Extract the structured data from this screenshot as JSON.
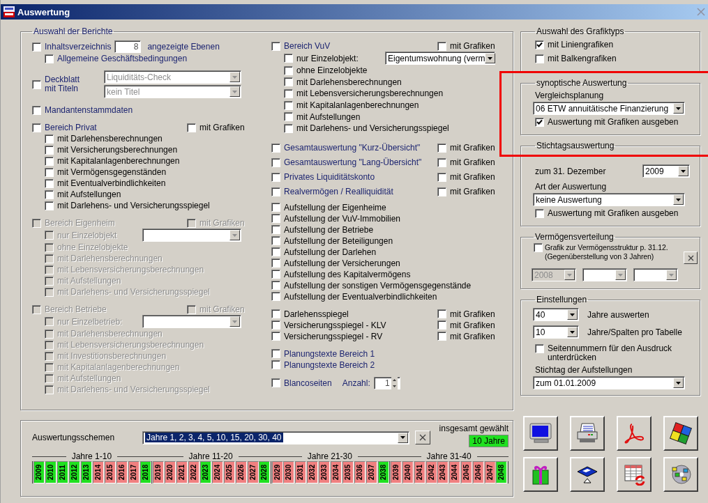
{
  "window": {
    "title": "Auswertung"
  },
  "report_selection": {
    "title": "Auswahl der Berichte",
    "columns": [
      {
        "groups": [
          {
            "disabled": false,
            "rows": [
              {
                "kind": "heading",
                "label": "Inhaltsverzeichnis",
                "checked": false,
                "field": {
                  "value": "8",
                  "suffix": "angezeigte Ebenen",
                  "spinner": false
                },
                "children": [
                  {
                    "kind": "heading",
                    "label": "Allgemeine Geschäftsbedingungen",
                    "checked": false
                  }
                ]
              }
            ]
          },
          {
            "disabled": false,
            "rows": [
              {
                "kind": "heading",
                "label": "Deckblatt mit Titeln",
                "checked": false,
                "dropdowns": [
                  {
                    "value": "Liquiditäts-Check",
                    "disabled": true
                  },
                  {
                    "value": "kein Titel",
                    "disabled": true
                  }
                ]
              }
            ]
          },
          {
            "disabled": false,
            "rows": [
              {
                "kind": "heading",
                "label": "Mandantenstammdaten",
                "checked": false
              }
            ]
          },
          {
            "disabled": false,
            "rows": [
              {
                "kind": "heading",
                "label": "Bereich Privat",
                "checked": false,
                "graphics": {
                  "label": "mit Grafiken",
                  "checked": false
                },
                "children": [
                  {
                    "kind": "option",
                    "label": "mit Darlehensberechnungen",
                    "checked": false
                  },
                  {
                    "kind": "option",
                    "label": "mit Versicherungsberechnungen",
                    "checked": false
                  },
                  {
                    "kind": "option",
                    "label": "mit Kapitalanlagenberechnungen",
                    "checked": false
                  },
                  {
                    "kind": "option",
                    "label": "mit Vermögensgegenständen",
                    "checked": false
                  },
                  {
                    "kind": "option",
                    "label": "mit Eventualverbindlichkeiten",
                    "checked": false
                  },
                  {
                    "kind": "option",
                    "label": "mit Aufstellungen",
                    "checked": false
                  },
                  {
                    "kind": "option",
                    "label": "mit Darlehens- und Versicherungsspiegel",
                    "checked": false
                  }
                ]
              }
            ]
          },
          {
            "disabled": true,
            "rows": [
              {
                "kind": "heading",
                "label": "Bereich Eigenheim",
                "checked": false,
                "graphics": {
                  "label": "mit Grafiken",
                  "checked": false
                },
                "children": [
                  {
                    "kind": "option",
                    "label": "nur Einzelobjekt",
                    "checked": false,
                    "dropdowns": [
                      {
                        "disabled": true
                      }
                    ]
                  },
                  {
                    "kind": "option",
                    "label": "ohne Einzelobjekte",
                    "checked": false
                  },
                  {
                    "kind": "option",
                    "label": "mit Darlehensberechnungen",
                    "checked": false
                  },
                  {
                    "kind": "option",
                    "label": "mit Lebensversicherungsberechnungen",
                    "checked": false
                  },
                  {
                    "kind": "option",
                    "label": "mit Aufstellungen",
                    "checked": false
                  },
                  {
                    "kind": "option",
                    "label": "mit Darlehens- und Versicherungsspiegel",
                    "checked": false
                  }
                ]
              }
            ]
          },
          {
            "disabled": true,
            "rows": [
              {
                "kind": "heading",
                "label": "Bereich Betriebe",
                "checked": false,
                "graphics": {
                  "label": "mit Grafiken",
                  "checked": false
                },
                "children": [
                  {
                    "kind": "option",
                    "label": "nur Einzelbetrieb:",
                    "checked": false,
                    "dropdowns": [
                      {
                        "disabled": true
                      }
                    ]
                  },
                  {
                    "kind": "option",
                    "label": "mit Darlehensberechnungen",
                    "checked": false
                  },
                  {
                    "kind": "option",
                    "label": "mit Lebensversicherungsberechnungen",
                    "checked": false
                  },
                  {
                    "kind": "option",
                    "label": "mit Investitionsberechnungen",
                    "checked": false
                  },
                  {
                    "kind": "option",
                    "label": "mit Kapitalanlagenberechnungen",
                    "checked": false
                  },
                  {
                    "kind": "option",
                    "label": "mit Aufstellungen",
                    "checked": false
                  },
                  {
                    "kind": "option",
                    "label": "mit Darlehens- und Versicherungsspiegel",
                    "checked": false
                  }
                ]
              }
            ]
          }
        ]
      },
      {
        "groups": [
          {
            "disabled": false,
            "rows": [
              {
                "kind": "heading",
                "label": "Bereich VuV",
                "checked": false,
                "graphics": {
                  "label": "mit Grafiken",
                  "checked": false
                },
                "children": [
                  {
                    "kind": "option",
                    "label": "nur Einzelobjekt:",
                    "checked": false,
                    "dropdowns": [
                      {
                        "value": "Eigentumswohnung (verm",
                        "disabled": false
                      }
                    ]
                  },
                  {
                    "kind": "option",
                    "label": "ohne Einzelobjekte",
                    "checked": false
                  },
                  {
                    "kind": "option",
                    "label": "mit Darlehensberechnungen",
                    "checked": false
                  },
                  {
                    "kind": "option",
                    "label": "mit Lebensversicherungsberechnungen",
                    "checked": false
                  },
                  {
                    "kind": "option",
                    "label": "mit Kapitalanlagenberechnungen",
                    "checked": false
                  },
                  {
                    "kind": "option",
                    "label": "mit Aufstellungen",
                    "checked": false
                  },
                  {
                    "kind": "option",
                    "label": "mit Darlehens- und Versicherungsspiegel",
                    "checked": false
                  }
                ]
              }
            ]
          },
          {
            "disabled": false,
            "rows": [
              {
                "kind": "heading",
                "label": "Gesamtauswertung \"Kurz-Übersicht\"",
                "checked": false,
                "graphics": {
                  "label": "mit Grafiken",
                  "checked": false
                }
              },
              {
                "kind": "heading",
                "label": "Gesamtauswertung \"Lang-Übersicht\"",
                "checked": false,
                "graphics": {
                  "label": "mit Grafiken",
                  "checked": false
                }
              },
              {
                "kind": "heading",
                "label": "Privates Liquiditätskonto",
                "checked": false,
                "graphics": {
                  "label": "mit Grafiken",
                  "checked": false
                }
              },
              {
                "kind": "heading",
                "label": "Realvermögen / Realliquidität",
                "checked": false,
                "graphics": {
                  "label": "mit Grafiken",
                  "checked": false
                }
              }
            ]
          },
          {
            "disabled": false,
            "rows": [
              {
                "kind": "option",
                "label": "Aufstellung der Eigenheime",
                "checked": false
              },
              {
                "kind": "option",
                "label": "Aufstellung der VuV-Immobilien",
                "checked": false
              },
              {
                "kind": "option",
                "label": "Aufstellung der Betriebe",
                "checked": false
              },
              {
                "kind": "option",
                "label": "Aufstellung der Beteiligungen",
                "checked": false
              },
              {
                "kind": "option",
                "label": "Aufstellung der Darlehen",
                "checked": false
              },
              {
                "kind": "option",
                "label": "Aufstellung der Versicherungen",
                "checked": false
              },
              {
                "kind": "option",
                "label": "Aufstellung des Kapitalvermögens",
                "checked": false
              },
              {
                "kind": "option",
                "label": "Aufstellung der sonstigen Vermögensgegenstände",
                "checked": false
              },
              {
                "kind": "option",
                "label": "Aufstellung der Eventualverbindlichkeiten",
                "checked": false
              }
            ]
          },
          {
            "disabled": false,
            "rows": [
              {
                "kind": "option",
                "label": "Darlehensspiegel",
                "checked": false,
                "graphics": {
                  "label": "mit Grafiken",
                  "checked": false
                }
              },
              {
                "kind": "option",
                "label": "Versicherungsspiegel - KLV",
                "checked": false,
                "graphics": {
                  "label": "mit Grafiken",
                  "checked": false
                }
              },
              {
                "kind": "option",
                "label": "Versicherungsspiegel - RV",
                "checked": false,
                "graphics": {
                  "label": "mit Grafiken",
                  "checked": false
                }
              }
            ]
          },
          {
            "disabled": false,
            "rows": [
              {
                "kind": "heading",
                "label": "Planungstexte Bereich 1",
                "checked": false
              },
              {
                "kind": "heading",
                "label": "Planungstexte Bereich 2",
                "checked": false
              }
            ]
          },
          {
            "disabled": false,
            "rows": [
              {
                "kind": "heading",
                "label": "Blancoseiten",
                "checked": false,
                "field": {
                  "prefix": "Anzahl:",
                  "value": "1",
                  "spinner": true
                }
              }
            ]
          }
        ]
      }
    ]
  },
  "chart_type": {
    "title": "Auswahl des Grafiktyps",
    "options": [
      {
        "label": "mit Liniengrafiken",
        "checked": true
      },
      {
        "label": "mit Balkengrafiken",
        "checked": false
      }
    ]
  },
  "synoptic": {
    "title": "synoptische Auswertung",
    "highlighted": true,
    "label": "Vergleichsplanung",
    "dropdown": {
      "value": "06  ETW annuitätische Finanzierung"
    },
    "graphics": {
      "label": "Auswertung mit Grafiken ausgeben",
      "checked": true
    }
  },
  "key_date": {
    "title": "Stichtagsauswertung",
    "date_label": "zum 31. Dezember",
    "year": {
      "value": "2009"
    },
    "type_label": "Art der Auswertung",
    "type": {
      "value": "keine Auswertung"
    },
    "graphics": {
      "label": "Auswertung mit Grafiken ausgeben",
      "checked": false
    }
  },
  "distribution": {
    "title": "Vermögensverteilung",
    "option": {
      "label": "Grafik zur Vermögensstruktur p. 31.12. (Gegenüberstellung von 3 Jahren)",
      "checked": false
    },
    "years": [
      {
        "value": "2008",
        "disabled": true
      },
      {
        "disabled": true
      },
      {
        "disabled": true
      }
    ]
  },
  "settings": {
    "title": "Einstellungen",
    "years": {
      "value": "40",
      "label": "Jahre auswerten"
    },
    "columns": {
      "value": "10",
      "label": "Jahre/Spalten pro Tabelle"
    },
    "page_numbers": {
      "label": "Seitennummern für den Ausdruck unterdrücken",
      "checked": false
    },
    "date_label": "Stichtag der Aufstellungen",
    "date": {
      "value": "zum 01.01.2009"
    }
  },
  "schemes": {
    "label": "Auswertungsschemen",
    "dropdown": {
      "value": "Jahre 1, 2, 3, 4, 5, 10, 15, 20, 30, 40"
    },
    "total_label": "insgesamt gewählt",
    "total": "10 Jahre",
    "decades": [
      {
        "label": "Jahre 1-10",
        "years": [
          {
            "label": "2009",
            "selected": true
          },
          {
            "label": "2010",
            "selected": true
          },
          {
            "label": "2011",
            "selected": true
          },
          {
            "label": "2012",
            "selected": true
          },
          {
            "label": "2013",
            "selected": true
          },
          {
            "label": "2014",
            "selected": false
          },
          {
            "label": "2015",
            "selected": false
          },
          {
            "label": "2016",
            "selected": false
          },
          {
            "label": "2017",
            "selected": false
          },
          {
            "label": "2018",
            "selected": true
          }
        ]
      },
      {
        "label": "Jahre 11-20",
        "years": [
          {
            "label": "2019",
            "selected": false
          },
          {
            "label": "2020",
            "selected": false
          },
          {
            "label": "2021",
            "selected": false
          },
          {
            "label": "2022",
            "selected": false
          },
          {
            "label": "2023",
            "selected": true
          },
          {
            "label": "2024",
            "selected": false
          },
          {
            "label": "2025",
            "selected": false
          },
          {
            "label": "2026",
            "selected": false
          },
          {
            "label": "2027",
            "selected": false
          },
          {
            "label": "2028",
            "selected": true
          }
        ]
      },
      {
        "label": "Jahre 21-30",
        "years": [
          {
            "label": "2029",
            "selected": false
          },
          {
            "label": "2030",
            "selected": false
          },
          {
            "label": "2031",
            "selected": false
          },
          {
            "label": "2032",
            "selected": false
          },
          {
            "label": "2033",
            "selected": false
          },
          {
            "label": "2034",
            "selected": false
          },
          {
            "label": "2035",
            "selected": false
          },
          {
            "label": "2036",
            "selected": false
          },
          {
            "label": "2037",
            "selected": false
          },
          {
            "label": "2038",
            "selected": true
          }
        ]
      },
      {
        "label": "Jahre 31-40",
        "years": [
          {
            "label": "2039",
            "selected": false
          },
          {
            "label": "2040",
            "selected": false
          },
          {
            "label": "2041",
            "selected": false
          },
          {
            "label": "2042",
            "selected": false
          },
          {
            "label": "2043",
            "selected": false
          },
          {
            "label": "2044",
            "selected": false
          },
          {
            "label": "2045",
            "selected": false
          },
          {
            "label": "2046",
            "selected": false
          },
          {
            "label": "2047",
            "selected": false
          },
          {
            "label": "2048",
            "selected": true
          }
        ]
      }
    ]
  },
  "actions": [
    {
      "kind": "monitor"
    },
    {
      "kind": "printer"
    },
    {
      "kind": "pdf"
    },
    {
      "kind": "puzzle"
    },
    {
      "kind": "gift"
    },
    {
      "kind": "floppy"
    },
    {
      "kind": "table"
    },
    {
      "kind": "disc"
    }
  ]
}
